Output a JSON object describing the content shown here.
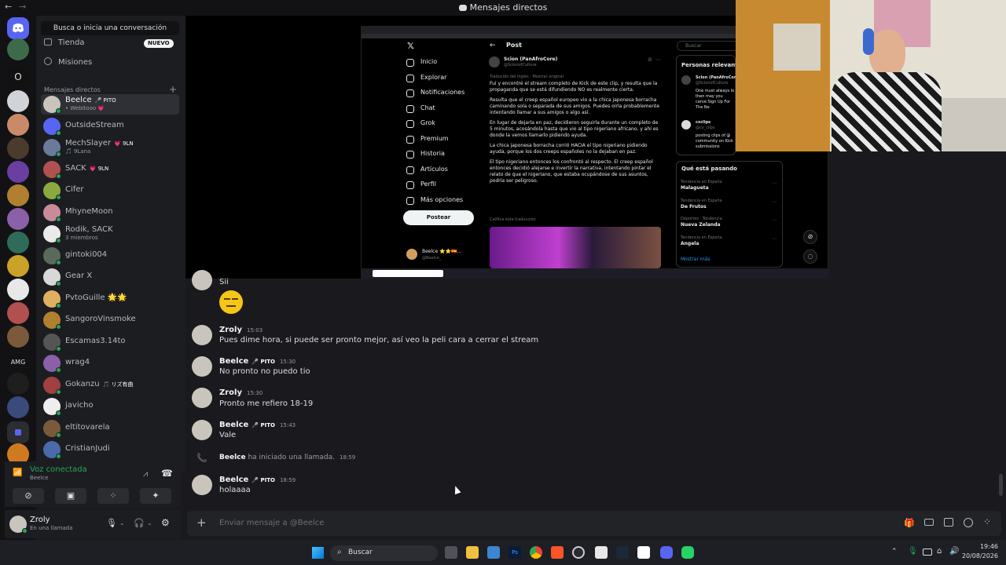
{
  "window": {
    "title": "Mensajes directos"
  },
  "sidebar": {
    "search_placeholder": "Busca o inicia una conversación",
    "nav": [
      {
        "label": "Tienda",
        "badge": "NUEVO"
      },
      {
        "label": "Misiones"
      }
    ],
    "dm_header": "Mensajes directos",
    "dms": [
      {
        "name": "Beelce",
        "badge": "🎤 PITO",
        "sub": "• Webitooo 💗"
      },
      {
        "name": "OutsideStream",
        "badge": "",
        "sub": ""
      },
      {
        "name": "MechSlayer",
        "badge": "💗 9LN",
        "sub": "🎵 9Lana"
      },
      {
        "name": "SACK",
        "badge": "💗 9LN",
        "sub": ""
      },
      {
        "name": "Cifer",
        "badge": "",
        "sub": ""
      },
      {
        "name": "MhyneMoon",
        "badge": "",
        "sub": ""
      },
      {
        "name": "Rodik, SACK",
        "badge": "",
        "sub": "3 miembros"
      },
      {
        "name": "gintoki004",
        "badge": "",
        "sub": ""
      },
      {
        "name": "Gear X",
        "badge": "",
        "sub": ""
      },
      {
        "name": "PvtoGuille 🌟🌟",
        "badge": "",
        "sub": ""
      },
      {
        "name": "SangoroVinsmoke",
        "badge": "",
        "sub": ""
      },
      {
        "name": "Escamas3.14to",
        "badge": "",
        "sub": ""
      },
      {
        "name": "wrag4",
        "badge": "",
        "sub": ""
      },
      {
        "name": "Gokanzu",
        "badge": "🎵 リズ有曲",
        "sub": ""
      },
      {
        "name": "javicho",
        "badge": "",
        "sub": ""
      },
      {
        "name": "eltitovarela",
        "badge": "",
        "sub": ""
      },
      {
        "name": "CristianJudi",
        "badge": "",
        "sub": ""
      }
    ]
  },
  "voice": {
    "status": "Voz conectada",
    "channel": "Beelce"
  },
  "user": {
    "name": "Zroly",
    "status": "En una llamada"
  },
  "guild_letter": "O",
  "guild_amg": "AMG",
  "twitter": {
    "nav": [
      "Inicio",
      "Explorar",
      "Notificaciones",
      "Chat",
      "Grok",
      "Premium",
      "Historia",
      "Artículos",
      "Perfil",
      "Más opciones"
    ],
    "post_button": "Postear",
    "header": "Post",
    "author": "Scion (PanAfroCore)",
    "handle": "@ScionofCulture",
    "translated": "Traducido del inglés · Mostrar original",
    "paragraphs": [
      "Fui y encontré el stream completo de Kick de este clip, y resulta que la propaganda que se está difundiendo NO es realmente cierta.",
      "Resulta que el creep español europeo vio a la chica japonesa borracha caminando sola o separada de sus amigos. Puedes oírla probablemente intentando llamar a sus amigos o algo así.",
      "En lugar de dejarla en paz, decidieron seguirla durante un completo de 5 minutos, acosándola hasta que vio al tipo nigeriano africano, y ahí es donde la vemos llamarlo pidiendo ayuda.",
      "La chica japonesa borracha corrió HACIA el tipo nigeriano pidiendo ayuda, porque los dos creeps españoles no la dejaban en paz.",
      "El tipo nigeriano entonces los confrontó al respecto. El creep español entonces decidió alejarse e invertir la narrativa, intentando pintar el relato de que el nigeriano, que estaba ocupándose de sus asuntos, podría ser peligroso."
    ],
    "rate": "Califica esta traducción",
    "footer_user": "Beelce ⭐⭐🇪🇸...",
    "footer_handle": "@Beelce_",
    "search": "Buscar",
    "relevant_title": "Personas relevantes",
    "relevant": [
      {
        "name": "Scion (PanAfroCore)",
        "handle": "@ScionofCulture",
        "bio": "One must always lo then may you carve Sign Up For The Ne watchii.net/5Pf..."
      },
      {
        "name": "cxclips",
        "handle": "@cx_clips",
        "bio": "posting clips of @ community on Kick submissions"
      }
    ],
    "happening_title": "Qué está pasando",
    "trends": [
      {
        "cat": "Tendencia en España",
        "name": "Malagueta"
      },
      {
        "cat": "Tendencia en España",
        "name": "De Frutos"
      },
      {
        "cat": "Deportes · Tendencia",
        "name": "Nueva Zelanda"
      },
      {
        "cat": "Tendencia en España",
        "name": "Angela"
      }
    ],
    "show_more": "Mostrar más"
  },
  "chat": {
    "messages": [
      {
        "user": "",
        "time": "",
        "text": "Sii"
      },
      {
        "user": "Zroly",
        "time": "15:03",
        "text": "Pues dime hora, si puede ser pronto mejor, así veo la peli cara a cerrar el stream"
      },
      {
        "user": "Beelce",
        "badge": "🎤 PITO",
        "time": "15:30",
        "text": "No pronto no puedo tio"
      },
      {
        "user": "Zroly",
        "time": "15:30",
        "text": "Pronto me refiero 18-19"
      },
      {
        "user": "Beelce",
        "badge": "🎤 PITO",
        "time": "15:43",
        "text": "Vale"
      },
      {
        "user": "Beelce",
        "badge": "🎤 PITO",
        "time": "18:59",
        "text": "holaaaa"
      }
    ],
    "call": {
      "user": "Beelce",
      "text": "ha iniciado una llamada.",
      "time": "18:59"
    },
    "composer_placeholder": "Enviar mensaje a @Beelce"
  },
  "taskbar": {
    "search": "Buscar",
    "time": "19:46",
    "date": "20/08/2026"
  },
  "colors": {
    "accent": "#5865f2",
    "green": "#23a55a",
    "bg": "#1a1a1e",
    "sidebar": "#1c1d21"
  }
}
